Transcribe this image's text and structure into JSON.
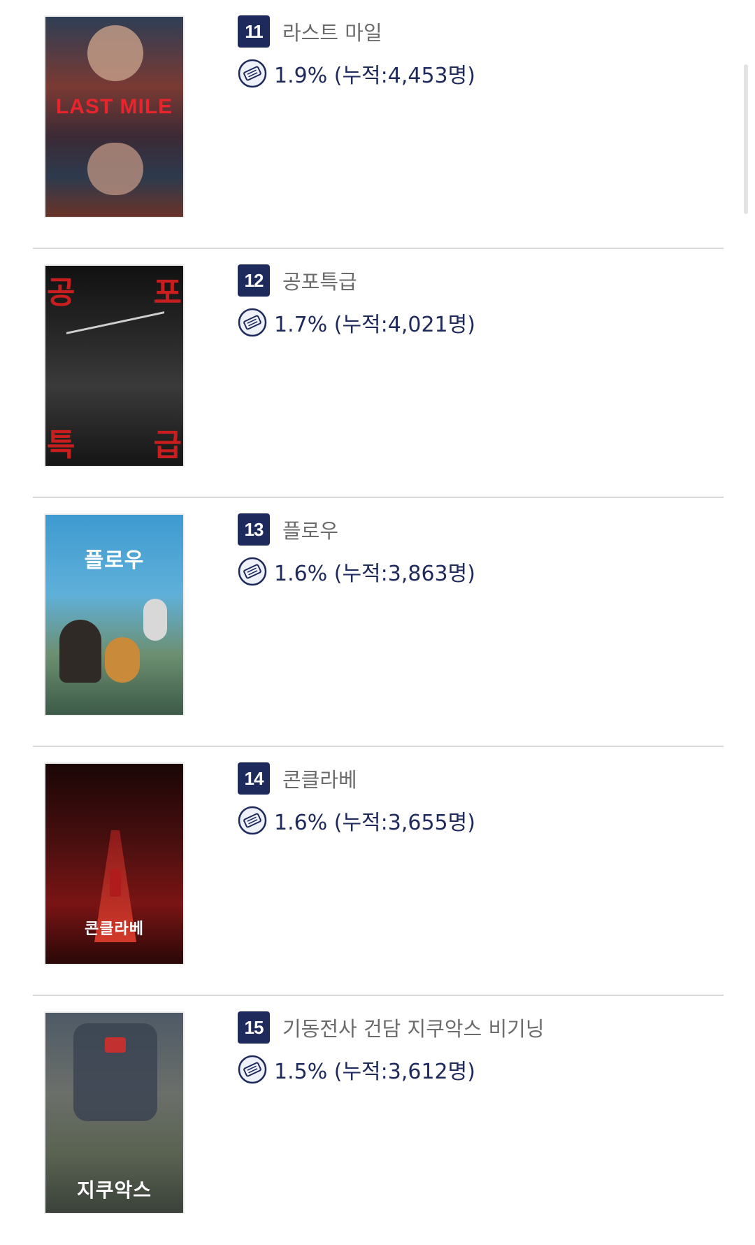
{
  "movies": [
    {
      "rank": "11",
      "title": "라스트 마일",
      "stat": "1.9% (누적:4,453명)",
      "poster_text": "LAST MILE",
      "poster_bg": "#5b3a34",
      "poster_accent": "#d2252c"
    },
    {
      "rank": "12",
      "title": "공포특급",
      "stat": "1.7% (누적:4,021명)",
      "poster_text": "공포특급",
      "poster_bg": "#1a1a1a",
      "poster_accent": "#c81e1e"
    },
    {
      "rank": "13",
      "title": "플로우",
      "stat": "1.6% (누적:3,863명)",
      "poster_text": "플로우",
      "poster_bg": "#3b8fc0",
      "poster_accent": "#ffffff"
    },
    {
      "rank": "14",
      "title": "콘클라베",
      "stat": "1.6% (누적:3,655명)",
      "poster_text": "콘클라베",
      "poster_bg": "#3a0c0c",
      "poster_accent": "#c72a24"
    },
    {
      "rank": "15",
      "title": "기동전사 건담 지쿠악스 비기닝",
      "stat": "1.5% (누적:3,612명)",
      "poster_text": "지쿠악스",
      "poster_bg": "#4a5560",
      "poster_accent": "#ffffff"
    }
  ],
  "colors": {
    "badge": "#1f2a5c",
    "stat_text": "#1f2a5c",
    "title_text": "#6b6b6b",
    "divider": "#d9d9d9"
  },
  "icons": {
    "stat_icon": "ticket-icon"
  }
}
